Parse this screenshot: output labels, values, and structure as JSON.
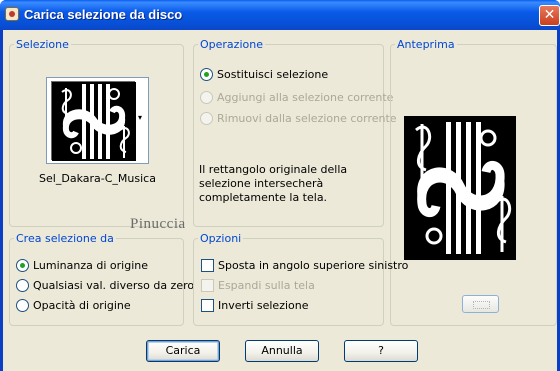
{
  "window": {
    "title": "Carica selezione da disco",
    "close_glyph": "✕"
  },
  "selection_group": {
    "title": "Selezione",
    "preset_name": "Sel_Dakara-C_Musica",
    "dropdown_glyph": "▾"
  },
  "operation_group": {
    "title": "Operazione",
    "options": [
      {
        "label": "Sostituisci selezione",
        "checked": true,
        "disabled": false
      },
      {
        "label": "Aggiungi alla selezione corrente",
        "checked": false,
        "disabled": true
      },
      {
        "label": "Rimuovi dalla selezione corrente",
        "checked": false,
        "disabled": true
      }
    ],
    "info": "Il rettangolo originale della selezione intersecherà completamente la tela."
  },
  "preview_group": {
    "title": "Anteprima"
  },
  "create_group": {
    "title": "Crea selezione da",
    "options": [
      {
        "label": "Luminanza di origine",
        "checked": true
      },
      {
        "label": "Qualsiasi val. diverso da zero",
        "checked": false
      },
      {
        "label": "Opacità di origine",
        "checked": false
      }
    ]
  },
  "options_group": {
    "title": "Opzioni",
    "checks": [
      {
        "label": "Sposta in angolo superiore sinistro",
        "checked": false,
        "disabled": false
      },
      {
        "label": "Espandi sulla tela",
        "checked": false,
        "disabled": true
      },
      {
        "label": "Inverti selezione",
        "checked": false,
        "disabled": false
      }
    ]
  },
  "watermark": "Pinuccia",
  "buttons": {
    "load": "Carica",
    "cancel": "Annulla",
    "help": "?"
  },
  "colors": {
    "titlebar": "#0a5ae8",
    "group_title": "#0046d5",
    "dialog_bg": "#ece9d8",
    "radio_check": "#21a121"
  }
}
